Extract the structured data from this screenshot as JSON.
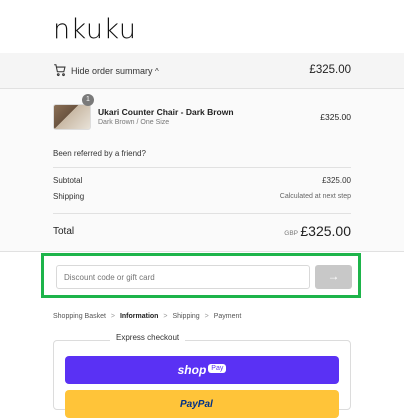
{
  "brand": {
    "logo": "nkuku"
  },
  "summary_toggle": {
    "label": "Hide order summary",
    "chevron": "^",
    "total": "£325.00",
    "icon": "cart-icon"
  },
  "item": {
    "quantity": "1",
    "name": "Ukari Counter Chair - Dark Brown",
    "variant": "Dark Brown / One Size",
    "price": "£325.00"
  },
  "referral": {
    "text": "Been referred by a friend?"
  },
  "totals": {
    "subtotal_label": "Subtotal",
    "subtotal_value": "£325.00",
    "shipping_label": "Shipping",
    "shipping_value": "Calculated at next step",
    "total_label": "Total",
    "currency": "GBP",
    "total_value": "£325.00"
  },
  "discount": {
    "placeholder": "Discount code or gift card",
    "apply_icon": "arrow-right-icon",
    "apply_symbol": "→"
  },
  "breadcrumb": {
    "items": [
      "Shopping Basket",
      "Information",
      "Shipping",
      "Payment"
    ],
    "separator": ">",
    "active": "Information"
  },
  "express": {
    "title": "Express checkout",
    "shoppay": {
      "shop": "shop",
      "pay": "Pay"
    },
    "paypal": {
      "label": "PayPal"
    }
  },
  "colors": {
    "highlight": "#1db44a",
    "shoppay": "#5a31f4",
    "paypal": "#ffc439"
  }
}
